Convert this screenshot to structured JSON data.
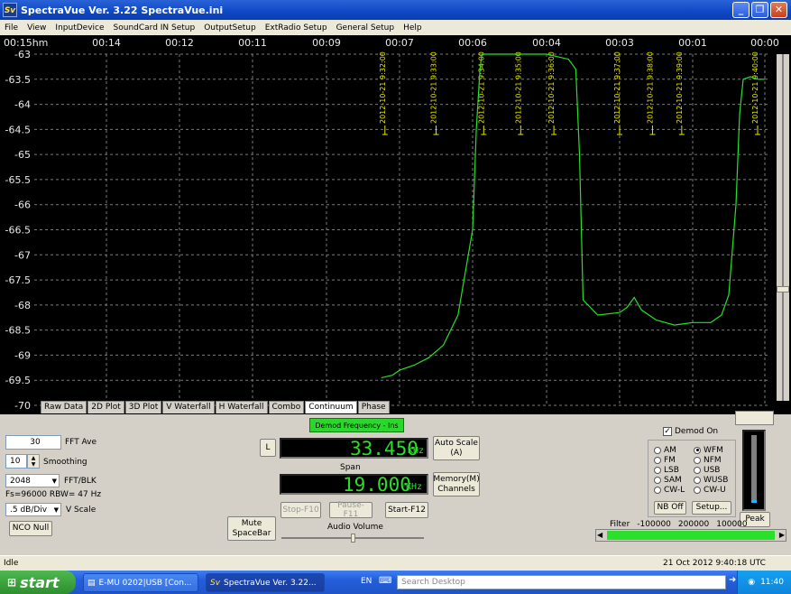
{
  "window": {
    "title": "SpectraVue Ver. 3.22 SpectraVue.ini",
    "icon": "Sv"
  },
  "menu": [
    "File",
    "View",
    "InputDevice",
    "SoundCard IN Setup",
    "OutputSetup",
    "ExtRadio Setup",
    "General Setup",
    "Help"
  ],
  "chart_data": {
    "type": "line",
    "x_ticks": [
      "00:15hm",
      "00:14",
      "00:12",
      "00:11",
      "00:09",
      "00:07",
      "00:06",
      "00:04",
      "00:03",
      "00:01",
      "00:00"
    ],
    "y_ticks": [
      "-63",
      "-63.5",
      "-64",
      "-64.5",
      "-65",
      "-65.5",
      "-66",
      "-66.5",
      "-67",
      "-67.5",
      "-68",
      "-68.5",
      "-69",
      "-69.5",
      "-70"
    ],
    "ylim": [
      -70,
      -63
    ],
    "line_color": "#27e127",
    "marker_color": "#e6e600",
    "timestamps": [
      "2012-10-21 9:32:00",
      "2012-10-21 9:33:00",
      "2012-10-21 9:34:00",
      "2012-10-21 9:35:00",
      "2012-10-21 9:36:00",
      "2012-10-21 9:37:00",
      "2012-10-21 9:38:00",
      "2012-10-21 9:39:00",
      "2012-10-21 9:40:00"
    ],
    "timestamp_minutes": [
      7.4,
      6.5,
      5.7,
      4.7,
      3.9,
      3.0,
      2.1,
      1.3,
      0.1
    ],
    "series": [
      {
        "minutes_ago": [
          7.5,
          7.2,
          7.0,
          6.8,
          6.6,
          6.4,
          6.2,
          6.0,
          5.9,
          5.8,
          5.75,
          5.5,
          5.0,
          4.5,
          4.0,
          3.7,
          3.6,
          3.55,
          3.5,
          3.3,
          3.0,
          2.8,
          2.6,
          2.4,
          2.0,
          1.5,
          1.0,
          0.75,
          0.6,
          0.5,
          0.4,
          0.35,
          0.3,
          0.2,
          0.1,
          0.0
        ],
        "values": [
          -69.45,
          -69.4,
          -69.3,
          -69.2,
          -69.05,
          -68.8,
          -68.2,
          -66.5,
          -64.5,
          -63.3,
          -63.0,
          -63.0,
          -63.0,
          -63.0,
          -63.0,
          -63.1,
          -63.3,
          -65.0,
          -67.9,
          -68.2,
          -68.15,
          -68.05,
          -67.85,
          -68.1,
          -68.3,
          -68.4,
          -68.35,
          -68.35,
          -68.2,
          -67.8,
          -66.0,
          -64.2,
          -63.5,
          -63.45,
          -63.5,
          -63.5
        ]
      }
    ]
  },
  "tabs": [
    "Raw Data",
    "2D Plot",
    "3D Plot",
    "V Waterfall",
    "H Waterfall",
    "Combo",
    "Continuum",
    "Phase"
  ],
  "active_tab": "Continuum",
  "controls": {
    "fft_ave_value": "30",
    "fft_ave_label": "FFT Ave",
    "smoothing_value": "10",
    "smoothing_label": "Smoothing",
    "fft_blk_value": "2048",
    "fft_blk_label": "FFT/BLK",
    "fs_info": "Fs=96000 RBW= 47 Hz",
    "vscale_value": ".5 dB/Div",
    "vscale_label": "V Scale",
    "nco_null": "NCO Null"
  },
  "demod": {
    "freq_label": "Demod Frequency - Ins",
    "l_button": "L",
    "freq_value": "33.450",
    "freq_unit": "KHz",
    "span_label": "Span",
    "span_value": "19.000",
    "span_unit": "KHz",
    "auto_scale": "Auto Scale\n(A)",
    "memory": "Memory(M)\nChannels",
    "mute": "Mute\nSpaceBar",
    "stop": "Stop-F10",
    "pause": "Pause-F11",
    "start": "Start-F12",
    "audio_volume": "Audio Volume",
    "audio_volume_level": 0.5
  },
  "modes": {
    "demod_on_label": "Demod On",
    "left": [
      "AM",
      "FM",
      "LSB",
      "SAM",
      "CW-L"
    ],
    "right": [
      "WFM",
      "NFM",
      "USB",
      "WUSB",
      "CW-U"
    ],
    "selected": "WFM",
    "nb_off": "NB Off",
    "setup": "Setup...",
    "peak": "Peak",
    "filter_label": "Filter",
    "filter_values": [
      "-100000",
      "200000",
      "100000"
    ]
  },
  "status": {
    "left": "Idle",
    "right": "21 Oct 2012  9:40:18 UTC"
  },
  "taskbar": {
    "start": "start",
    "tasks": [
      "E-MU 0202|USB [Con...",
      "SpectraVue Ver. 3.22..."
    ],
    "lang": "EN",
    "search_placeholder": "Search Desktop",
    "clock": "11:40"
  }
}
